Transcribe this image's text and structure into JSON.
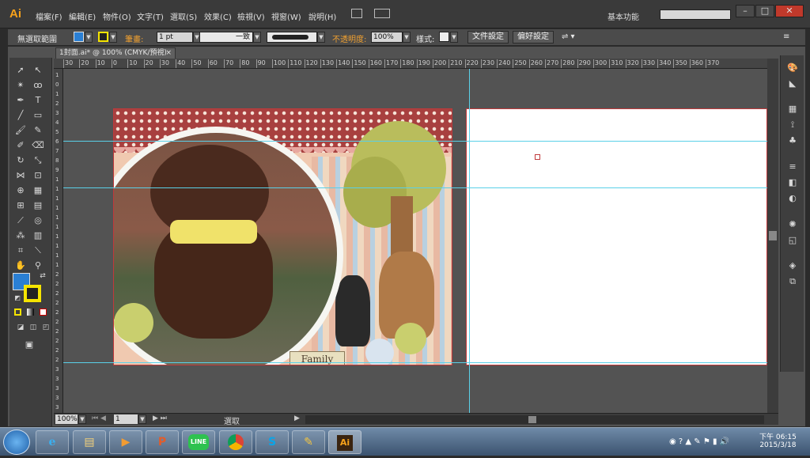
{
  "app": {
    "logo": "Ai"
  },
  "menu": {
    "items": [
      "檔案(F)",
      "編輯(E)",
      "物件(O)",
      "文字(T)",
      "選取(S)",
      "效果(C)",
      "檢視(V)",
      "視窗(W)",
      "說明(H)"
    ],
    "workspace": "基本功能",
    "search_placeholder": ""
  },
  "control_bar": {
    "selection_label": "無選取範圍",
    "stroke_label": "筆畫:",
    "stroke_value": "1 pt",
    "stroke_style": "一致",
    "opacity_label": "不透明度:",
    "opacity_value": "100%",
    "style_label": "樣式:",
    "doc_setup_button": "文件設定",
    "preferences_button": "偏好設定"
  },
  "document_tab": {
    "title": "1封面.ai* @ 100% (CMYK/預視)",
    "close": "×"
  },
  "ruler": {
    "top_ticks": [
      "30",
      "20",
      "10",
      "0",
      "10",
      "20",
      "30",
      "40",
      "50",
      "60",
      "70",
      "80",
      "90",
      "100",
      "110",
      "120",
      "130",
      "140",
      "150",
      "160",
      "170",
      "180",
      "190",
      "200",
      "210",
      "220",
      "230",
      "240",
      "250",
      "260",
      "270",
      "280",
      "290",
      "300",
      "310",
      "320",
      "330",
      "340",
      "350",
      "360",
      "370"
    ],
    "left_ticks": [
      "1",
      "0",
      "1",
      "2",
      "3",
      "4",
      "5",
      "6",
      "7",
      "8",
      "9",
      "1",
      "1",
      "1",
      "1",
      "1",
      "1",
      "1",
      "1",
      "1",
      "1",
      "2",
      "2",
      "2",
      "2",
      "2",
      "2",
      "2",
      "2",
      "2",
      "2",
      "3",
      "3",
      "3",
      "3",
      "3"
    ]
  },
  "artboard": {
    "family_text": "Family"
  },
  "status_bar": {
    "zoom": "100%",
    "page": "1",
    "mode": "選取"
  },
  "colors": {
    "fill": "#2a7fd4",
    "stroke": "#f5e400",
    "artboard_border": "#c0393b",
    "guide": "#5ad0e8",
    "accent": "#f7a21b"
  },
  "taskbar": {
    "apps": [
      "windows-start",
      "internet-explorer",
      "file-explorer",
      "media-player",
      "ppt",
      "line",
      "chrome",
      "skype",
      "paint",
      "illustrator"
    ],
    "time": "下午 06:15",
    "date": "2015/3/18",
    "line_label": "LINE",
    "ai_label": "Ai"
  }
}
